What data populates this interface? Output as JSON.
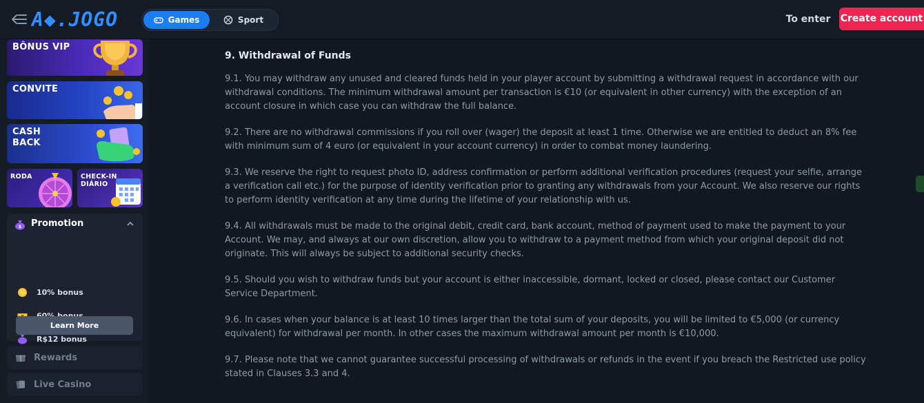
{
  "header": {
    "logo_text": "A◆.JOGO",
    "nav": {
      "games_label": "Games",
      "sport_label": "Sport"
    },
    "to_enter_label": "To enter",
    "create_account_label": "Create account"
  },
  "sidebar": {
    "cards": {
      "vip": "BÔNUS VIP",
      "convite": "CONVITE",
      "cashback_line1": "CASH",
      "cashback_line2": "BACK",
      "roda": "RODA",
      "checkin_line1": "CHECK-IN",
      "checkin_line2": "DIÁRIO"
    },
    "promotion": {
      "title": "Promotion",
      "items": [
        {
          "label": "10% bonus",
          "icon": "coin-icon"
        },
        {
          "label": "60% bonus",
          "icon": "treasure-icon"
        },
        {
          "label": "R$12 bonus",
          "icon": "money-bag-icon"
        }
      ],
      "learn_more_label": "Learn More"
    },
    "links": [
      {
        "label": "Rewards",
        "icon": "gift-icon"
      },
      {
        "label": "Live Casino",
        "icon": "cards-icon"
      }
    ]
  },
  "main": {
    "heading": "9. Withdrawal of Funds",
    "paragraphs": [
      "9.1. You may withdraw any unused and cleared funds held in your player account by submitting a withdrawal request in accordance with our withdrawal conditions. The minimum withdrawal amount per transaction is €10 (or equivalent in other currency) with the exception of an account closure in which case you can withdraw the full balance.",
      "9.2. There are no withdrawal commissions if you roll over (wager) the deposit at least 1 time. Otherwise we are entitled to deduct an 8% fee with minimum sum of 4 euro (or equivalent in your account currency) in order to combat money laundering.",
      "9.3. We reserve the right to request photo ID, address confirmation or perform additional verification procedures (request your selfie, arrange a verification call etc.) for the purpose of identity verification prior to granting any withdrawals from your Account. We also reserve our rights to perform identity verification at any time during the lifetime of your relationship with us.",
      "9.4. All withdrawals must be made to the original debit, credit card, bank account, method of payment used to make the payment to your Account. We may, and always at our own discretion, allow you to withdraw to a payment method from which your original deposit did not originate. This will always be subject to additional security checks.",
      "9.5. Should you wish to withdraw funds but your account is either inaccessible, dormant, locked or closed, please contact our Customer Service Department.",
      "9.6. In cases when your balance is at least 10 times larger than the total sum of your deposits, you will be limited to €5,000 (or currency equivalent) for withdrawal per month. In other cases the maximum withdrawal amount per month is €10,000.",
      "9.7. Please note that we cannot guarantee successful processing of withdrawals or refunds in the event if you breach the Restricted use policy stated in Clauses 3.3 and 4."
    ]
  },
  "colors": {
    "accent_blue": "#1c7cf2",
    "create_account_red": "#ee2452",
    "background": "#121820"
  }
}
